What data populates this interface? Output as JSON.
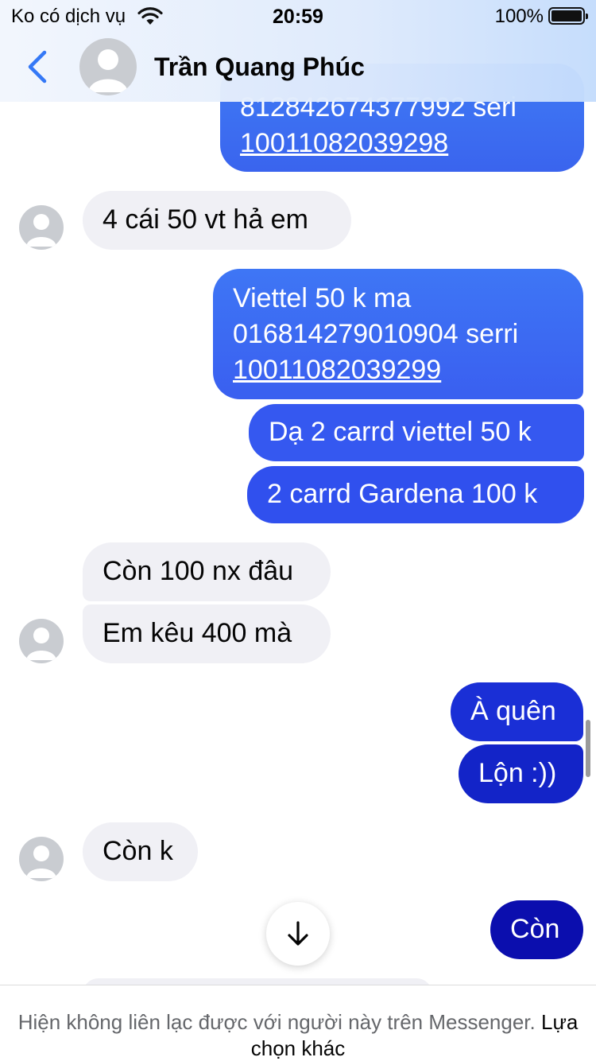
{
  "status_bar": {
    "carrier": "Ko có dịch vụ",
    "time": "20:59",
    "battery_percent": "100%"
  },
  "header": {
    "contact_name": "Trần Quang Phúc"
  },
  "messages": [
    {
      "sender": "me",
      "lines": [
        "812842674377992 seri",
        "10011082039298"
      ]
    },
    {
      "sender": "contact",
      "text": "4 cái 50 vt hả em"
    },
    {
      "sender": "me",
      "lines": [
        "Viettel 50 k ma",
        "016814279010904 serri",
        "10011082039299"
      ]
    },
    {
      "sender": "me",
      "text": "Dạ 2 carrd viettel 50 k"
    },
    {
      "sender": "me",
      "text": "2 carrd Gardena 100 k"
    },
    {
      "sender": "contact",
      "text": "Còn 100 nx đâu"
    },
    {
      "sender": "contact",
      "text": "Em kêu 400 mà"
    },
    {
      "sender": "me",
      "text": "À quên"
    },
    {
      "sender": "me",
      "text": "Lộn :))"
    },
    {
      "sender": "contact",
      "text": "Còn k"
    },
    {
      "sender": "me",
      "text": "Còn"
    }
  ],
  "footer": {
    "notice_text": "Hiện không liên lạc được với người này trên Messenger.",
    "notice_link": "Lựa chọn khác"
  },
  "icons": {
    "back": "chevron-left-icon",
    "scroll_down": "arrow-down-icon",
    "avatar": "default-avatar-icon",
    "wifi": "wifi-icon",
    "battery": "battery-icon"
  },
  "colors": {
    "accent": "#3478f6",
    "outgoing_top": "#3a63ee",
    "outgoing_bottom": "#0a0aa8",
    "incoming": "#f0f0f5"
  }
}
